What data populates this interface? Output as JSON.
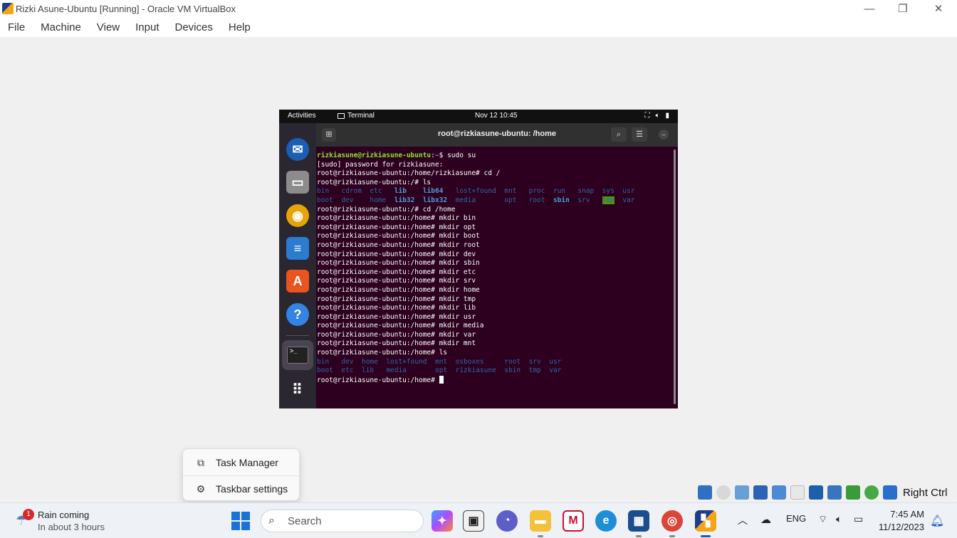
{
  "window": {
    "title": "Rizki Asune-Ubuntu [Running] - Oracle VM VirtualBox",
    "minimize": "—",
    "restore": "❐",
    "close": "✕"
  },
  "menubar": [
    "File",
    "Machine",
    "View",
    "Input",
    "Devices",
    "Help"
  ],
  "ubuntu": {
    "topbar": {
      "activities": "Activities",
      "app": "Terminal",
      "clock": "Nov 12  10:45"
    },
    "terminal": {
      "title": "root@rizkiasune-ubuntu: /home",
      "lines": [
        {
          "parts": [
            {
              "t": "rizkiasune@rizkiasune-ubuntu",
              "c": "prompt-user"
            },
            {
              "t": ":",
              "c": ""
            },
            {
              "t": "~",
              "c": "prompt-path"
            },
            {
              "t": "$ sudo su",
              "c": ""
            }
          ]
        },
        {
          "parts": [
            {
              "t": "[sudo] password for rizkiasune:",
              "c": ""
            }
          ]
        },
        {
          "parts": [
            {
              "t": "root@rizkiasune-ubuntu:/home/rizkiasune# cd /",
              "c": ""
            }
          ]
        },
        {
          "parts": [
            {
              "t": "root@rizkiasune-ubuntu:/# ls",
              "c": ""
            }
          ]
        },
        {
          "parts": [
            {
              "t": "bin",
              "c": "dirname"
            },
            {
              "t": "   ",
              "c": ""
            },
            {
              "t": "cdrom",
              "c": "dirname"
            },
            {
              "t": "  ",
              "c": ""
            },
            {
              "t": "etc",
              "c": "dirname"
            },
            {
              "t": "   ",
              "c": ""
            },
            {
              "t": "lib",
              "c": "dirbold"
            },
            {
              "t": "    ",
              "c": ""
            },
            {
              "t": "lib64",
              "c": "dirbold"
            },
            {
              "t": "   ",
              "c": ""
            },
            {
              "t": "lost+found",
              "c": "dirname"
            },
            {
              "t": "  ",
              "c": ""
            },
            {
              "t": "mnt",
              "c": "dirname"
            },
            {
              "t": "   ",
              "c": ""
            },
            {
              "t": "proc",
              "c": "dirname"
            },
            {
              "t": "  ",
              "c": ""
            },
            {
              "t": "run",
              "c": "dirname"
            },
            {
              "t": "   ",
              "c": ""
            },
            {
              "t": "snap",
              "c": "dirname"
            },
            {
              "t": "  ",
              "c": ""
            },
            {
              "t": "sys",
              "c": "dirname"
            },
            {
              "t": "  ",
              "c": ""
            },
            {
              "t": "usr",
              "c": "dirname"
            }
          ]
        },
        {
          "parts": [
            {
              "t": "boot",
              "c": "dirname"
            },
            {
              "t": "  ",
              "c": ""
            },
            {
              "t": "dev",
              "c": "dirname"
            },
            {
              "t": "    ",
              "c": ""
            },
            {
              "t": "home",
              "c": "dirname"
            },
            {
              "t": "  ",
              "c": ""
            },
            {
              "t": "lib32",
              "c": "dirbold"
            },
            {
              "t": "  ",
              "c": ""
            },
            {
              "t": "libx32",
              "c": "dirbold"
            },
            {
              "t": "  ",
              "c": ""
            },
            {
              "t": "media",
              "c": "dirname"
            },
            {
              "t": "       ",
              "c": ""
            },
            {
              "t": "opt",
              "c": "dirname"
            },
            {
              "t": "   ",
              "c": ""
            },
            {
              "t": "root",
              "c": "dirname"
            },
            {
              "t": "  ",
              "c": ""
            },
            {
              "t": "sbin",
              "c": "dirbold"
            },
            {
              "t": "  ",
              "c": ""
            },
            {
              "t": "srv",
              "c": "dirname"
            },
            {
              "t": "   ",
              "c": ""
            },
            {
              "t": "tmp",
              "c": "tmpdir"
            },
            {
              "t": "  ",
              "c": ""
            },
            {
              "t": "var",
              "c": "dirname"
            }
          ]
        },
        {
          "parts": [
            {
              "t": "root@rizkiasune-ubuntu:/# cd /home",
              "c": ""
            }
          ]
        },
        {
          "parts": [
            {
              "t": "root@rizkiasune-ubuntu:/home# mkdir bin",
              "c": ""
            }
          ]
        },
        {
          "parts": [
            {
              "t": "root@rizkiasune-ubuntu:/home# mkdir opt",
              "c": ""
            }
          ]
        },
        {
          "parts": [
            {
              "t": "root@rizkiasune-ubuntu:/home# mkdir boot",
              "c": ""
            }
          ]
        },
        {
          "parts": [
            {
              "t": "root@rizkiasune-ubuntu:/home# mkdir root",
              "c": ""
            }
          ]
        },
        {
          "parts": [
            {
              "t": "root@rizkiasune-ubuntu:/home# mkdir dev",
              "c": ""
            }
          ]
        },
        {
          "parts": [
            {
              "t": "root@rizkiasune-ubuntu:/home# mkdir sbin",
              "c": ""
            }
          ]
        },
        {
          "parts": [
            {
              "t": "root@rizkiasune-ubuntu:/home# mkdir etc",
              "c": ""
            }
          ]
        },
        {
          "parts": [
            {
              "t": "root@rizkiasune-ubuntu:/home# mkdir srv",
              "c": ""
            }
          ]
        },
        {
          "parts": [
            {
              "t": "root@rizkiasune-ubuntu:/home# mkdir home",
              "c": ""
            }
          ]
        },
        {
          "parts": [
            {
              "t": "root@rizkiasune-ubuntu:/home# mkdir tmp",
              "c": ""
            }
          ]
        },
        {
          "parts": [
            {
              "t": "root@rizkiasune-ubuntu:/home# mkdir lib",
              "c": ""
            }
          ]
        },
        {
          "parts": [
            {
              "t": "root@rizkiasune-ubuntu:/home# mkdir usr",
              "c": ""
            }
          ]
        },
        {
          "parts": [
            {
              "t": "root@rizkiasune-ubuntu:/home# mkdir media",
              "c": ""
            }
          ]
        },
        {
          "parts": [
            {
              "t": "root@rizkiasune-ubuntu:/home# mkdir var",
              "c": ""
            }
          ]
        },
        {
          "parts": [
            {
              "t": "root@rizkiasune-ubuntu:/home# mkdir mnt",
              "c": ""
            }
          ]
        },
        {
          "parts": [
            {
              "t": "root@rizkiasune-ubuntu:/home# ls",
              "c": ""
            }
          ]
        },
        {
          "parts": [
            {
              "t": "bin",
              "c": "dirname"
            },
            {
              "t": "   ",
              "c": ""
            },
            {
              "t": "dev",
              "c": "dirname"
            },
            {
              "t": "  ",
              "c": ""
            },
            {
              "t": "home",
              "c": "dirname"
            },
            {
              "t": "  ",
              "c": ""
            },
            {
              "t": "lost+found",
              "c": "dirname"
            },
            {
              "t": "  ",
              "c": ""
            },
            {
              "t": "mnt",
              "c": "dirname"
            },
            {
              "t": "  ",
              "c": ""
            },
            {
              "t": "osboxes",
              "c": "dirname"
            },
            {
              "t": "     ",
              "c": ""
            },
            {
              "t": "root",
              "c": "dirname"
            },
            {
              "t": "  ",
              "c": ""
            },
            {
              "t": "srv",
              "c": "dirname"
            },
            {
              "t": "  ",
              "c": ""
            },
            {
              "t": "usr",
              "c": "dirname"
            }
          ]
        },
        {
          "parts": [
            {
              "t": "boot",
              "c": "dirname"
            },
            {
              "t": "  ",
              "c": ""
            },
            {
              "t": "etc",
              "c": "dirname"
            },
            {
              "t": "  ",
              "c": ""
            },
            {
              "t": "lib",
              "c": "dirname"
            },
            {
              "t": "   ",
              "c": ""
            },
            {
              "t": "media",
              "c": "dirname"
            },
            {
              "t": "       ",
              "c": ""
            },
            {
              "t": "opt",
              "c": "dirname"
            },
            {
              "t": "  ",
              "c": ""
            },
            {
              "t": "rizkiasune",
              "c": "dirname"
            },
            {
              "t": "  ",
              "c": ""
            },
            {
              "t": "sbin",
              "c": "dirname"
            },
            {
              "t": "  ",
              "c": ""
            },
            {
              "t": "tmp",
              "c": "dirname"
            },
            {
              "t": "  ",
              "c": ""
            },
            {
              "t": "var",
              "c": "dirname"
            }
          ]
        },
        {
          "parts": [
            {
              "t": "root@rizkiasune-ubuntu:/home# ",
              "c": ""
            }
          ],
          "cursor": true
        }
      ]
    }
  },
  "context_menu": {
    "items": [
      {
        "label": "Task Manager",
        "icon": "task-manager-icon"
      },
      {
        "label": "Taskbar settings",
        "icon": "gear-icon"
      }
    ]
  },
  "vbox_status": {
    "host_key": "Right Ctrl"
  },
  "taskbar": {
    "weather": {
      "badge": "1",
      "title": "Rain coming",
      "subtitle": "In about 3 hours"
    },
    "search_label": "Search",
    "language": "ENG",
    "time": "7:45 AM",
    "date": "11/12/2023"
  }
}
